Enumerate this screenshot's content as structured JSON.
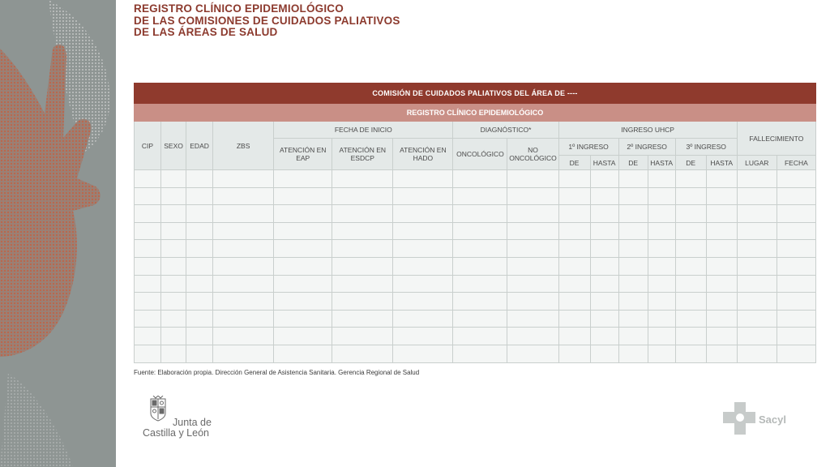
{
  "header": {
    "title_line1": "REGISTRO CLÍNICO EPIDEMIOLÓGICO",
    "title_line2": "DE LAS COMISIONES DE CUIDADOS PALIATIVOS",
    "title_line3": "DE LAS ÁREAS DE SALUD"
  },
  "table": {
    "title": "COMISIÓN DE CUIDADOS PALIATIVOS DEL ÁREA DE ----",
    "subtitle": "REGISTRO CLÍNICO EPIDEMIOLÓGICO",
    "col_cip": "CIP",
    "col_sexo": "SEXO",
    "col_edad": "EDAD",
    "col_zbs": "ZBS",
    "grp_fecha_inicio": "FECHA DE INICIO",
    "col_atencion_eap": "ATENCIÓN EN EAP",
    "col_atencion_esdcp": "ATENCIÓN EN ESDCP",
    "col_atencion_hado": "ATENCIÓN EN HADO",
    "grp_diagnostico": "DIAGNÓSTICO*",
    "col_oncologico": "ONCOLÓGICO",
    "col_no_oncologico": "NO ONCOLÓGICO",
    "grp_ingreso_uhcp": "INGRESO UHCP",
    "col_ingreso_1": "1º INGRESO",
    "col_ingreso_2": "2º INGRESO",
    "col_ingreso_3": "3º INGRESO",
    "lbl_de": "DE",
    "lbl_hasta": "HASTA",
    "grp_fallecimiento": "FALLECIMIENTO",
    "col_lugar": "LUGAR",
    "col_fecha": "FECHA"
  },
  "footer": {
    "source": "Fuente: Elaboración propia. Dirección General de Asistencia Sanitaria. Gerencia Regional de Salud",
    "logo_left_line1": "Junta de",
    "logo_left_line2": "Castilla y León",
    "logo_right": "Sacyl"
  },
  "colors": {
    "title_bar": "#8f3a2d",
    "subtitle_bar": "#c98f86",
    "header_cells": "#e4e9e8",
    "data_cells": "#f4f6f5",
    "title_text": "#8c3a2e"
  }
}
